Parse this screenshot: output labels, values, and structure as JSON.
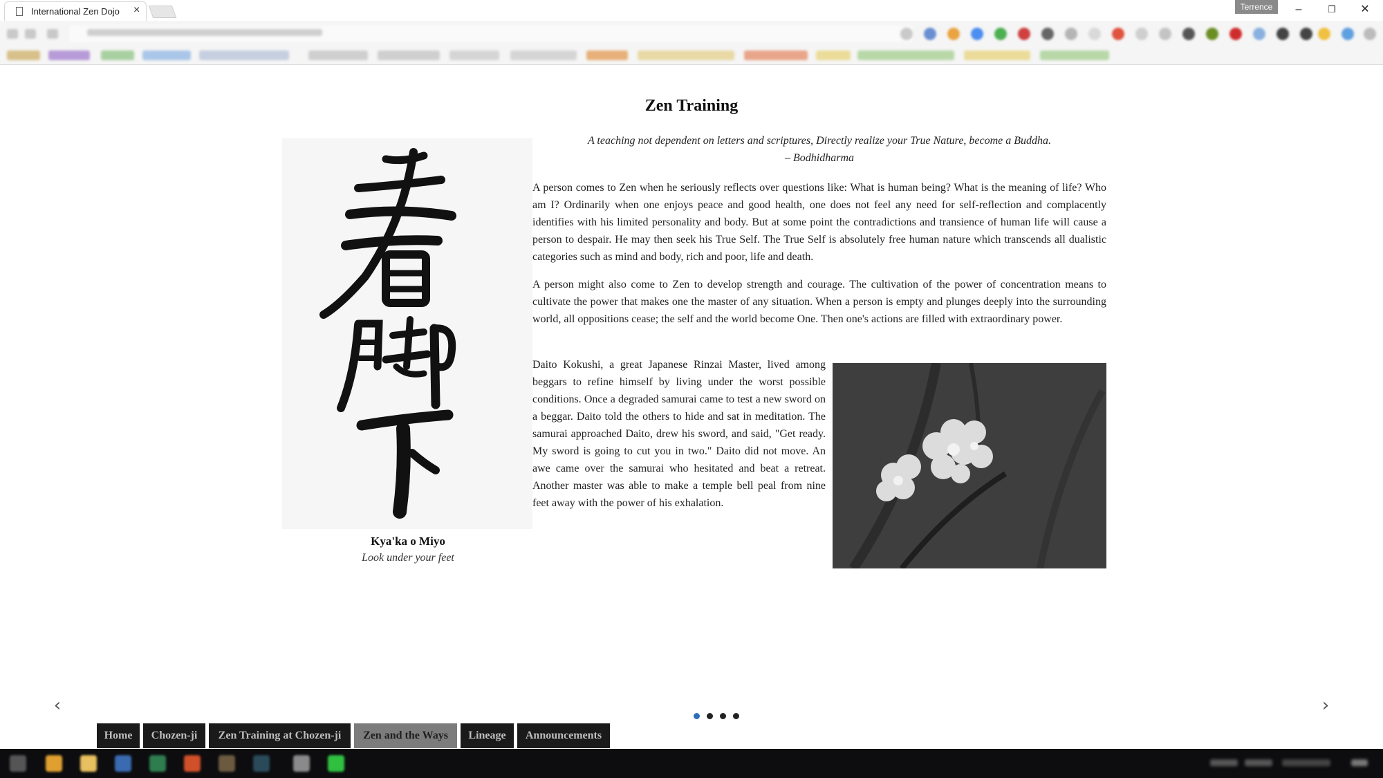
{
  "browser": {
    "tab_title": "International Zen Dojo",
    "tab_close_icon": "×",
    "user_name": "Terrence",
    "window_controls": {
      "minimize": "–",
      "restore": "❐",
      "close": "✕"
    }
  },
  "page": {
    "title": "Zen Training",
    "calligraphy": {
      "caption_title": "Kya'ka o Miyo",
      "caption_subtitle": "Look under your feet"
    },
    "quote": {
      "text": "A teaching not dependent on letters and scriptures, Directly realize your True Nature, become a Buddha.",
      "author": "– Bodhidharma"
    },
    "paragraphs": [
      "A person comes to Zen when he seriously reflects over questions like: What is human being? What is the meaning of life? Who am I? Ordinarily when one enjoys peace and good health, one does not feel any need for self-reflection and complacently identifies with his limited personality and body. But at some point the contradictions and transience of human life will cause a person to despair. He may then seek his True Self. The True Self is absolutely free human nature which transcends all dualistic categories such as mind and body, rich and poor, life and death.",
      "A person might also come to Zen to develop strength and courage. The cultivation of the power of concentration means to cultivate the power that makes one the master of any situation. When a person is empty and plunges deeply into the surrounding world, all oppositions cease; the self and the world become One. Then one's actions are filled with extraordinary power.",
      "Daito Kokushi, a great Japanese Rinzai Master, lived among beggars to refine himself by living under the worst possible conditions. Once a degraded samurai came to test a new sword on a beggar. Daito told the others to hide and sat in meditation. The samurai approached Daito, drew his sword, and said, \"Get ready. My sword is going to cut you in two.\" Daito did not move. An awe came over the samurai who hesitated and beat a retreat. Another master was able to make a temple bell peal from nine feet away with the power of his exhalation."
    ]
  },
  "slider": {
    "prev_icon": "‹",
    "next_icon": "›",
    "slide_count": 4,
    "active_slide": 1
  },
  "nav": {
    "items": [
      {
        "label": "Home",
        "active": false
      },
      {
        "label": "Chozen-ji",
        "active": false
      },
      {
        "label": "Zen Training at Chozen-ji",
        "active": false
      },
      {
        "label": "Zen and the Ways",
        "active": true
      },
      {
        "label": "Lineage",
        "active": false
      },
      {
        "label": "Announcements",
        "active": false
      }
    ]
  },
  "colors": {
    "nav_bg": "#1a1a1a",
    "nav_active_bg": "#7c7c7c",
    "dot_active": "#2d6fb6",
    "taskbar": "#0d0d0f"
  }
}
